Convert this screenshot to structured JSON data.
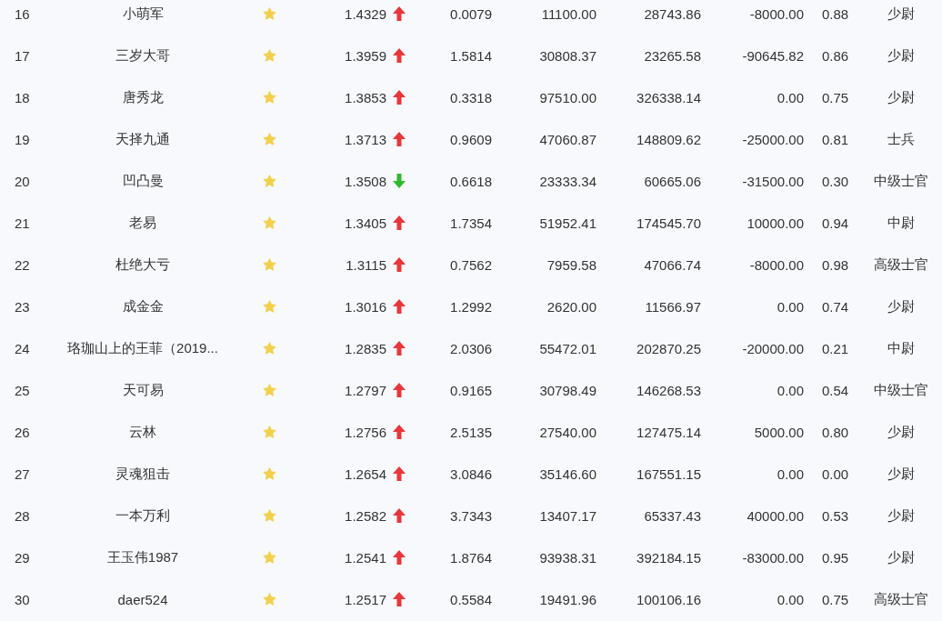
{
  "table": {
    "rows": [
      {
        "column_1": "16",
        "column_2": "小萌军",
        "column_4": "1.4329",
        "rising": true,
        "column_6": "0.0079",
        "column_7": "11100.00",
        "column_8": "28743.86",
        "column_9": "-8000.00",
        "column_10": "0.88",
        "column_11": "少尉"
      },
      {
        "column_1": "17",
        "column_2": "三岁大哥",
        "column_4": "1.3959",
        "rising": true,
        "column_6": "1.5814",
        "column_7": "30808.37",
        "column_8": "23265.58",
        "column_9": "-90645.82",
        "column_10": "0.86",
        "column_11": "少尉"
      },
      {
        "column_1": "18",
        "column_2": "唐秀龙",
        "column_4": "1.3853",
        "rising": true,
        "column_6": "0.3318",
        "column_7": "97510.00",
        "column_8": "326338.14",
        "column_9": "0.00",
        "column_10": "0.75",
        "column_11": "少尉"
      },
      {
        "column_1": "19",
        "column_2": "天择九通",
        "column_4": "1.3713",
        "rising": true,
        "column_6": "0.9609",
        "column_7": "47060.87",
        "column_8": "148809.62",
        "column_9": "-25000.00",
        "column_10": "0.81",
        "column_11": "士兵"
      },
      {
        "column_1": "20",
        "column_2": "凹凸曼",
        "column_4": "1.3508",
        "rising": false,
        "column_6": "0.6618",
        "column_7": "23333.34",
        "column_8": "60665.06",
        "column_9": "-31500.00",
        "column_10": "0.30",
        "column_11": "中级士官"
      },
      {
        "column_1": "21",
        "column_2": "老易",
        "column_4": "1.3405",
        "rising": true,
        "column_6": "1.7354",
        "column_7": "51952.41",
        "column_8": "174545.70",
        "column_9": "10000.00",
        "column_10": "0.94",
        "column_11": "中尉"
      },
      {
        "column_1": "22",
        "column_2": "杜绝大亏",
        "column_4": "1.3115",
        "rising": true,
        "column_6": "0.7562",
        "column_7": "7959.58",
        "column_8": "47066.74",
        "column_9": "-8000.00",
        "column_10": "0.98",
        "column_11": "高级士官"
      },
      {
        "column_1": "23",
        "column_2": "成金金",
        "column_4": "1.3016",
        "rising": true,
        "column_6": "1.2992",
        "column_7": "2620.00",
        "column_8": "11566.97",
        "column_9": "0.00",
        "column_10": "0.74",
        "column_11": "少尉"
      },
      {
        "column_1": "24",
        "column_2": "珞珈山上的王菲（2019...",
        "column_4": "1.2835",
        "rising": true,
        "column_6": "2.0306",
        "column_7": "55472.01",
        "column_8": "202870.25",
        "column_9": "-20000.00",
        "column_10": "0.21",
        "column_11": "中尉"
      },
      {
        "column_1": "25",
        "column_2": "天可易",
        "column_4": "1.2797",
        "rising": true,
        "column_6": "0.9165",
        "column_7": "30798.49",
        "column_8": "146268.53",
        "column_9": "0.00",
        "column_10": "0.54",
        "column_11": "中级士官"
      },
      {
        "column_1": "26",
        "column_2": "云林",
        "column_4": "1.2756",
        "rising": true,
        "column_6": "2.5135",
        "column_7": "27540.00",
        "column_8": "127475.14",
        "column_9": "5000.00",
        "column_10": "0.80",
        "column_11": "少尉"
      },
      {
        "column_1": "27",
        "column_2": "灵魂狙击",
        "column_4": "1.2654",
        "rising": true,
        "column_6": "3.0846",
        "column_7": "35146.60",
        "column_8": "167551.15",
        "column_9": "0.00",
        "column_10": "0.00",
        "column_11": "少尉"
      },
      {
        "column_1": "28",
        "column_2": "一本万利",
        "column_4": "1.2582",
        "rising": true,
        "column_6": "3.7343",
        "column_7": "13407.17",
        "column_8": "65337.43",
        "column_9": "40000.00",
        "column_10": "0.53",
        "column_11": "少尉"
      },
      {
        "column_1": "29",
        "column_2": "王玉伟1987",
        "column_4": "1.2541",
        "rising": true,
        "column_6": "1.8764",
        "column_7": "93938.31",
        "column_8": "392184.15",
        "column_9": "-83000.00",
        "column_10": "0.95",
        "column_11": "少尉"
      },
      {
        "column_1": "30",
        "column_2": "daer524",
        "column_4": "1.2517",
        "rising": true,
        "column_6": "0.5584",
        "column_7": "19491.96",
        "column_8": "100106.16",
        "column_9": "0.00",
        "column_10": "0.75",
        "column_11": "高级士官"
      }
    ]
  }
}
